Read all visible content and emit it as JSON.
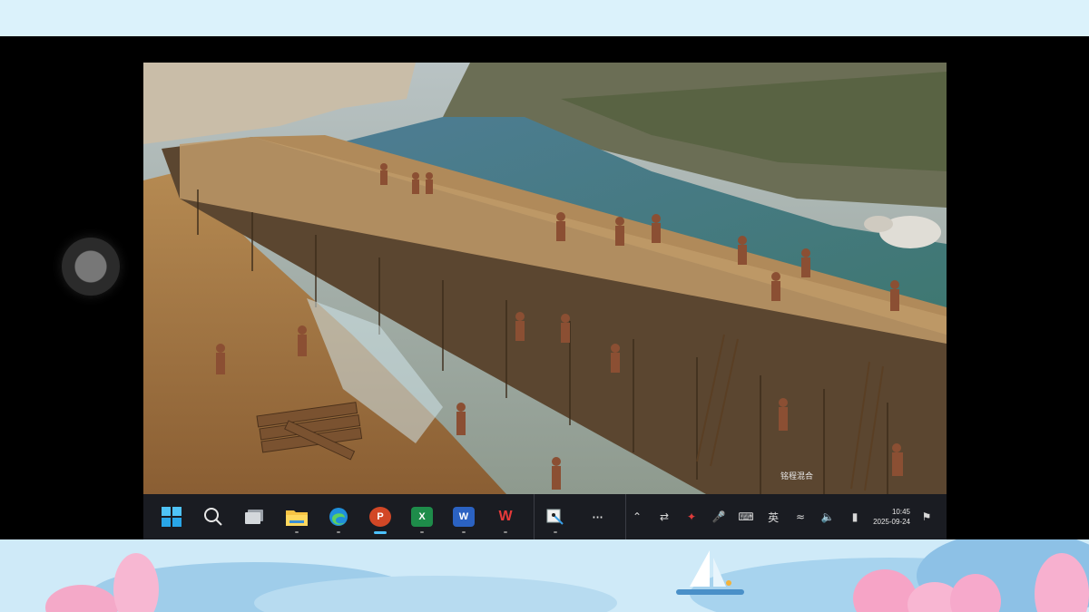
{
  "taskbar": {
    "apps": [
      {
        "name": "start",
        "label": ""
      },
      {
        "name": "search",
        "label": ""
      },
      {
        "name": "task-view",
        "label": ""
      },
      {
        "name": "file-explorer",
        "label": ""
      },
      {
        "name": "edge",
        "label": ""
      },
      {
        "name": "powerpoint",
        "label": "P"
      },
      {
        "name": "excel",
        "label": "X"
      },
      {
        "name": "word",
        "label": "W"
      },
      {
        "name": "wps",
        "label": "W"
      },
      {
        "name": "snipping-tool",
        "label": ""
      },
      {
        "name": "more",
        "label": "···"
      }
    ],
    "tray": {
      "ime_label": "英",
      "time": "10:45",
      "date": "2025-09-24"
    }
  },
  "screen": {
    "watermark": "铭程混合"
  },
  "colors": {
    "taskbar_bg": "#1a1c22",
    "active_indicator": "#4cc2ff",
    "top_band": "#dbf2fb"
  }
}
